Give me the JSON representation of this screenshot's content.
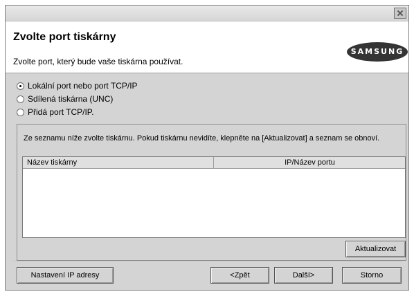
{
  "header": {
    "title": "Zvolte port tiskárny",
    "subtitle": "Zvolte port, který bude vaše tiskárna používat.",
    "logo_text": "SAMSUNG"
  },
  "port_options": [
    {
      "label": "Lokální port nebo port TCP/IP",
      "checked": true
    },
    {
      "label": "Sdílená tiskárna (UNC)",
      "checked": false
    },
    {
      "label": "Přidá port TCP/IP.",
      "checked": false
    }
  ],
  "printer_group": {
    "instructions": "Ze seznamu níže zvolte tiskárnu. Pokud tiskárnu nevidíte, klepněte na [Aktualizovat] a seznam se obnoví.",
    "columns": [
      "Název tiskárny",
      "IP/Název portu"
    ],
    "rows": [],
    "refresh_button": "Aktualizovat"
  },
  "footer": {
    "ip_settings_button": "Nastavení IP adresy",
    "back_button": "<Zpět",
    "next_button": "Další>",
    "cancel_button": "Storno"
  }
}
